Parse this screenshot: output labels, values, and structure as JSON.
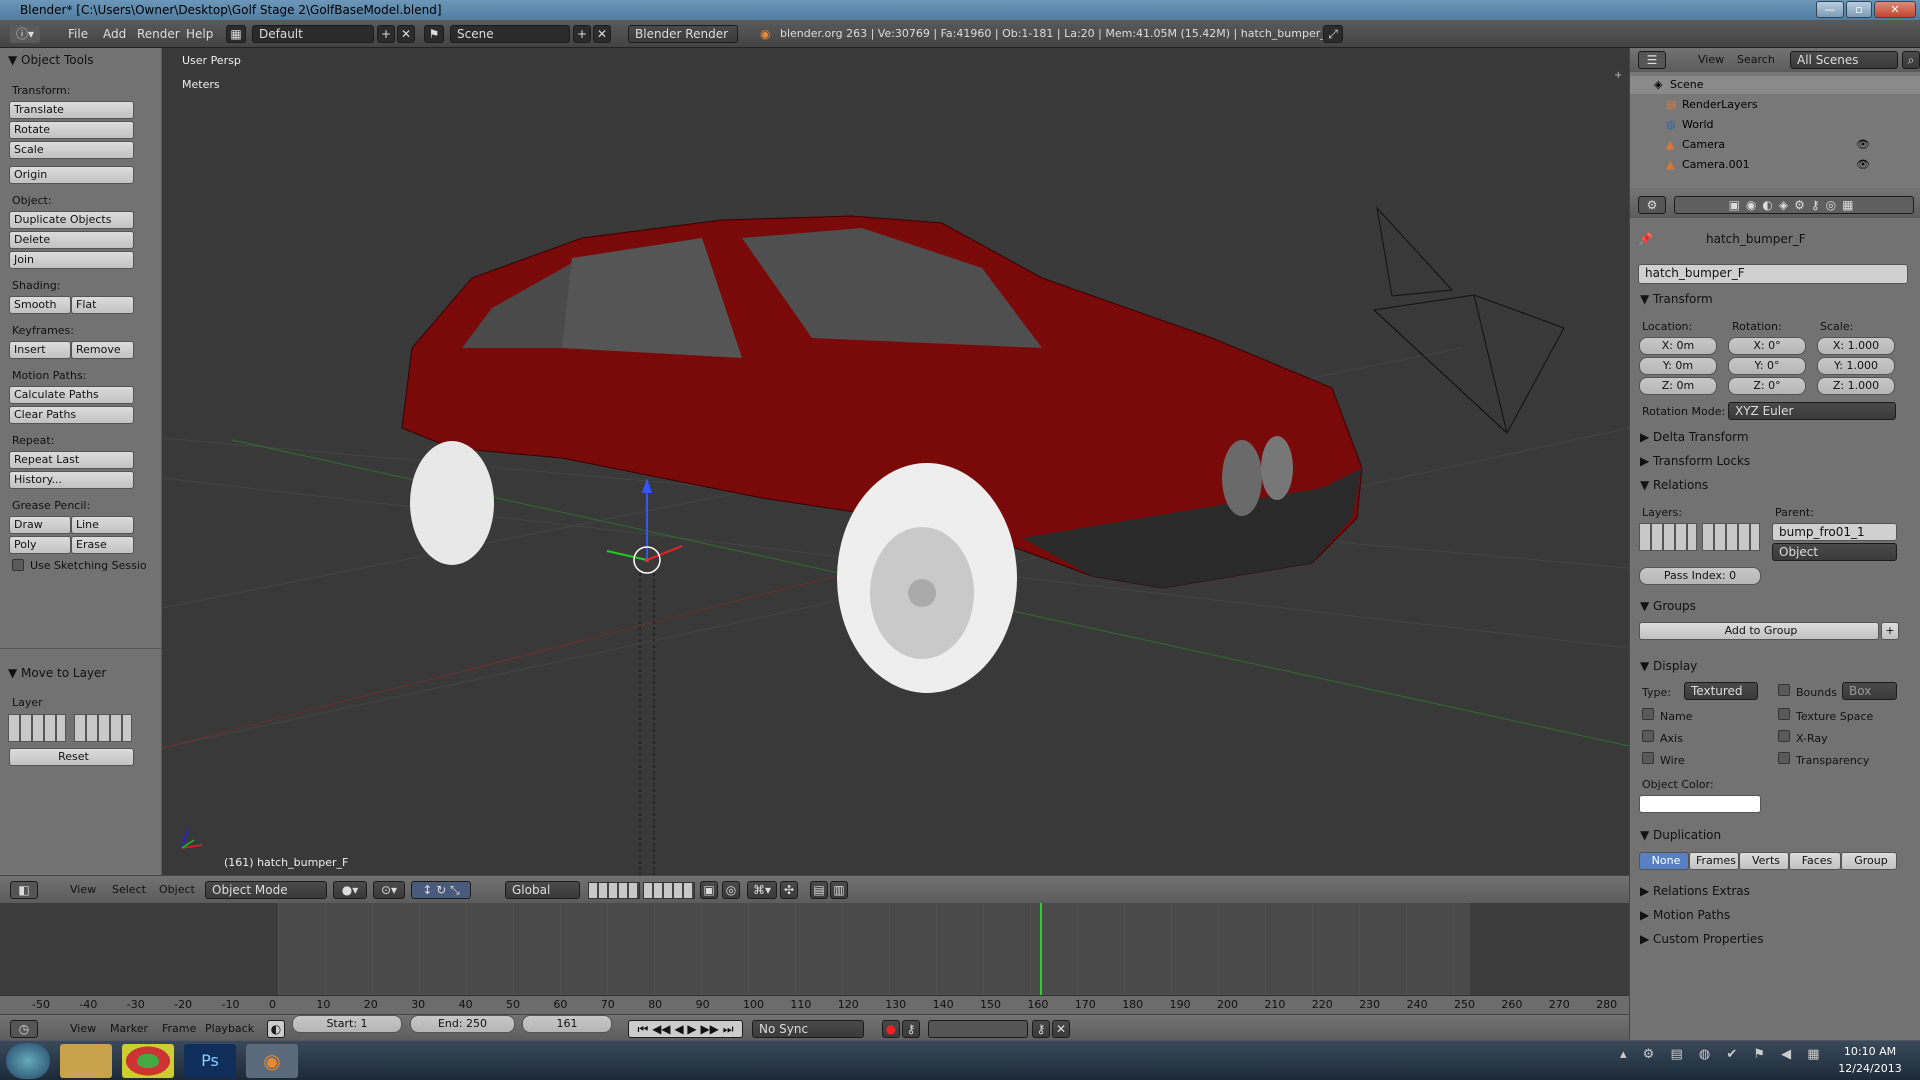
{
  "window": {
    "title": "Blender* [C:\\Users\\Owner\\Desktop\\Golf Stage 2\\GolfBaseModel.blend]"
  },
  "info_header": {
    "menus": [
      "File",
      "Add",
      "Render",
      "Help"
    ],
    "layout": "Default",
    "scene": "Scene",
    "engine": "Blender Render",
    "stats": "blender.org 263 | Ve:30769 | Fa:41960 | Ob:1-181 | La:20 | Mem:41.05M (15.42M) | hatch_bumper_F"
  },
  "tool_shelf": {
    "title": "Object Tools",
    "transform_label": "Transform:",
    "translate": "Translate",
    "rotate": "Rotate",
    "scale": "Scale",
    "origin": "Origin",
    "object_label": "Object:",
    "duplicate": "Duplicate Objects",
    "delete": "Delete",
    "join": "Join",
    "shading_label": "Shading:",
    "smooth": "Smooth",
    "flat": "Flat",
    "keyframes_label": "Keyframes:",
    "insert": "Insert",
    "remove": "Remove",
    "motion_label": "Motion Paths:",
    "calc_paths": "Calculate Paths",
    "clear_paths": "Clear Paths",
    "repeat_label": "Repeat:",
    "repeat_last": "Repeat Last",
    "history": "History...",
    "grease_label": "Grease Pencil:",
    "draw": "Draw",
    "line": "Line",
    "poly": "Poly",
    "erase": "Erase",
    "sketching": "Use Sketching Sessio",
    "move_layer_title": "Move to Layer",
    "layer_label": "Layer",
    "reset": "Reset"
  },
  "viewport": {
    "view_name": "User Persp",
    "units": "Meters",
    "object_info": "(161) hatch_bumper_F"
  },
  "viewport_header": {
    "menus": [
      "View",
      "Select",
      "Object"
    ],
    "mode": "Object Mode",
    "orientation": "Global"
  },
  "timeline": {
    "ticks": [
      "-50",
      "-40",
      "-30",
      "-20",
      "-10",
      "0",
      "10",
      "20",
      "30",
      "40",
      "50",
      "60",
      "70",
      "80",
      "90",
      "100",
      "110",
      "120",
      "130",
      "140",
      "150",
      "160",
      "170",
      "180",
      "190",
      "200",
      "210",
      "220",
      "230",
      "240",
      "250",
      "260",
      "270",
      "280"
    ],
    "current_frame_value": 161,
    "menus": [
      "View",
      "Marker",
      "Frame",
      "Playback"
    ],
    "start": "Start: 1",
    "end": "End: 250",
    "current": "161",
    "sync": "No Sync"
  },
  "outliner": {
    "menus": [
      "View",
      "Search"
    ],
    "filter": "All Scenes",
    "items": [
      "Scene",
      "RenderLayers",
      "World",
      "Camera",
      "Camera.001"
    ]
  },
  "properties": {
    "breadcrumb": "hatch_bumper_F",
    "object_name": "hatch_bumper_F",
    "transform": {
      "title": "Transform",
      "location_label": "Location:",
      "rotation_label": "Rotation:",
      "scale_label": "Scale:",
      "loc": [
        "X: 0m",
        "Y: 0m",
        "Z: 0m"
      ],
      "rot": [
        "X: 0°",
        "Y: 0°",
        "Z: 0°"
      ],
      "scl": [
        "X: 1.000",
        "Y: 1.000",
        "Z: 1.000"
      ],
      "rotation_mode_label": "Rotation Mode:",
      "rotation_mode": "XYZ Euler"
    },
    "delta_transform": "Delta Transform",
    "transform_locks": "Transform Locks",
    "relations": {
      "title": "Relations",
      "layers_label": "Layers:",
      "parent_label": "Parent:",
      "parent": "bump_fro01_1",
      "parent_type": "Object",
      "pass_index": "Pass Index: 0"
    },
    "groups": {
      "title": "Groups",
      "add": "Add to Group"
    },
    "display": {
      "title": "Display",
      "type_label": "Type:",
      "type": "Textured",
      "bounds": "Bounds",
      "bounds_type": "Box",
      "name": "Name",
      "texture_space": "Texture Space",
      "axis": "Axis",
      "xray": "X-Ray",
      "wire": "Wire",
      "transparency": "Transparency",
      "color_label": "Object Color:"
    },
    "duplication": {
      "title": "Duplication",
      "options": [
        "None",
        "Frames",
        "Verts",
        "Faces",
        "Group"
      ]
    },
    "relations_extras": "Relations Extras",
    "motion_paths": "Motion Paths",
    "custom_props": "Custom Properties"
  },
  "taskbar": {
    "time": "10:10 AM",
    "date": "12/24/2013"
  }
}
